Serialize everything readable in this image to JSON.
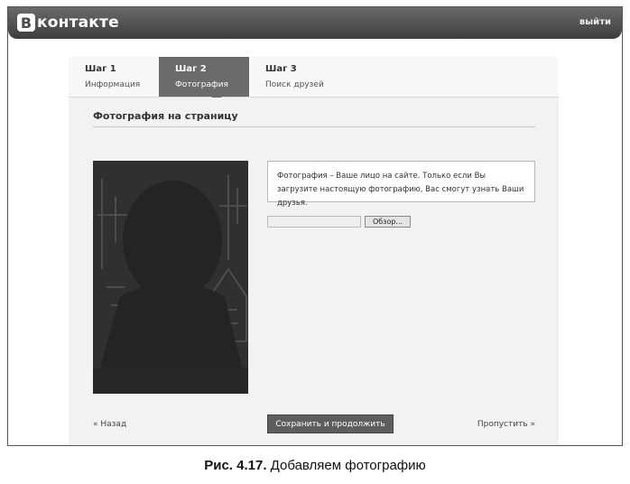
{
  "header": {
    "logo_letter": "В",
    "logo_text": "контакте",
    "logout_label": "выйти"
  },
  "steps": [
    {
      "title": "Шаг 1",
      "subtitle": "Информация",
      "active": false
    },
    {
      "title": "Шаг 2",
      "subtitle": "Фотография",
      "active": true
    },
    {
      "title": "Шаг 3",
      "subtitle": "Поиск друзей",
      "active": false
    }
  ],
  "section": {
    "title": "Фотография на страницу"
  },
  "info_text": "Фотография – Ваше лицо на сайте. Только если Вы загрузите настоящую фотографию, Вас смогут узнать Ваши друзья.",
  "upload": {
    "file_value": "",
    "browse_label": "Обзор..."
  },
  "footer_nav": {
    "back_label": "« Назад",
    "save_label": "Сохранить и продолжить",
    "skip_label": "Пропустить »"
  },
  "caption": {
    "prefix": "Рис. 4.17.",
    "text": "Добавляем фотографию"
  },
  "colors": {
    "topbar": "#4a4a4a",
    "active_step": "#6b6b6b",
    "save_button": "#5e5e5e"
  }
}
